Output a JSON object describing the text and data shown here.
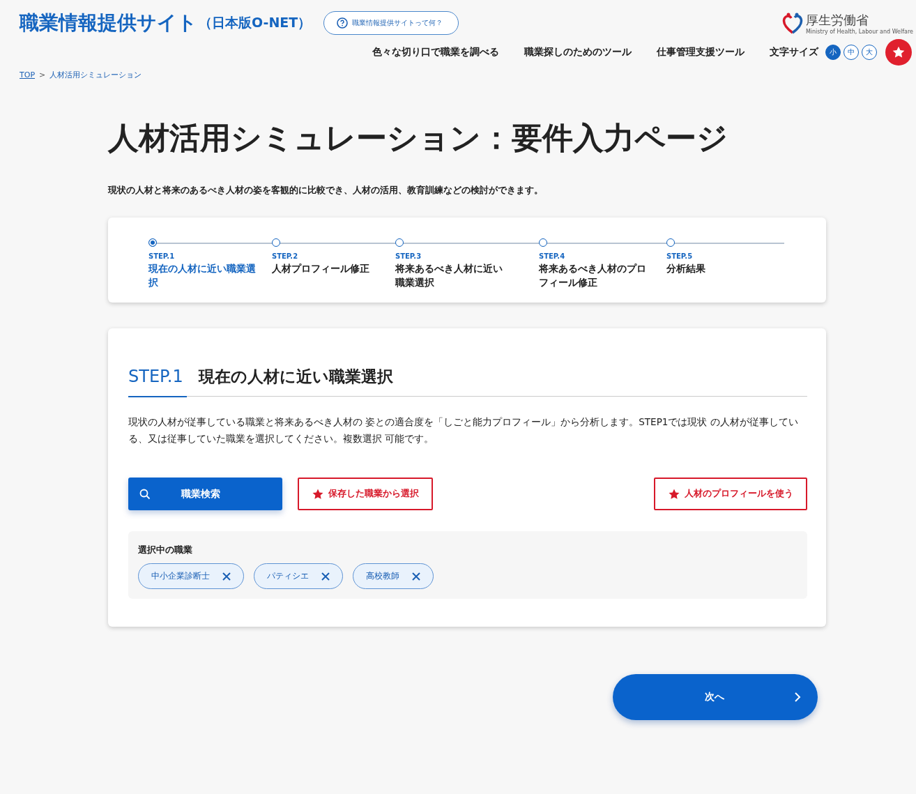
{
  "header": {
    "site_title": "職業情報提供サイト",
    "site_subtitle": "（日本版O-NET）",
    "help_link": "職業情報提供サイトって何？",
    "logo": {
      "name": "厚生労働省",
      "english": "Ministry of Health, Labour and Welfare"
    }
  },
  "nav": [
    "色々な切り口で職業を調べる",
    "職業探しのためのツール",
    "仕事管理支援ツール"
  ],
  "font_size": {
    "label": "文字サイズ",
    "options": [
      {
        "label": "小",
        "selected": true
      },
      {
        "label": "中",
        "selected": false
      },
      {
        "label": "大",
        "selected": false
      }
    ]
  },
  "breadcrumb_separator": ">",
  "breadcrumb": [
    {
      "label": "TOP",
      "kind": "link"
    },
    {
      "label": "人材活用シミュレーション",
      "kind": "current"
    }
  ],
  "page_title": "人材活用シミュレーション：要件入力ページ",
  "description": "現状の人材と将来のあるべき人材の姿を客観的に比較でき、人材の活用、教育訓練などの検討ができます。",
  "steps": [
    {
      "number": "STEP.1",
      "label": "現在の人材に近い職業選択",
      "selected": true
    },
    {
      "number": "STEP.2",
      "label": "人材プロフィール修正",
      "selected": false
    },
    {
      "number": "STEP.3",
      "label": "将来あるべき人材に近い職業選択",
      "selected": false
    },
    {
      "number": "STEP.4",
      "label": "将来あるべき人材のプロフィール修正",
      "selected": false
    },
    {
      "number": "STEP.5",
      "label": "分析結果",
      "selected": false
    }
  ],
  "section": {
    "step": "STEP.1",
    "title": "現在の人材に近い職業選択",
    "text": "現状の人材が従事している職業と将来あるべき人材の 姿との適合度を「しごと能力プロフィール」から分析します。STEP1では現状 の人材が従事している、又は従事していた職業を選択してください。複数選択 可能です。",
    "search_button": "職業検索",
    "saved_button": "保存した職業から選択",
    "profile_button": "人材のプロフィールを使う",
    "selected_label": "選択中の職業",
    "selected_jobs": [
      "中小企業診断士",
      "パティシエ",
      "高校教師"
    ]
  },
  "next_button": "次へ"
}
